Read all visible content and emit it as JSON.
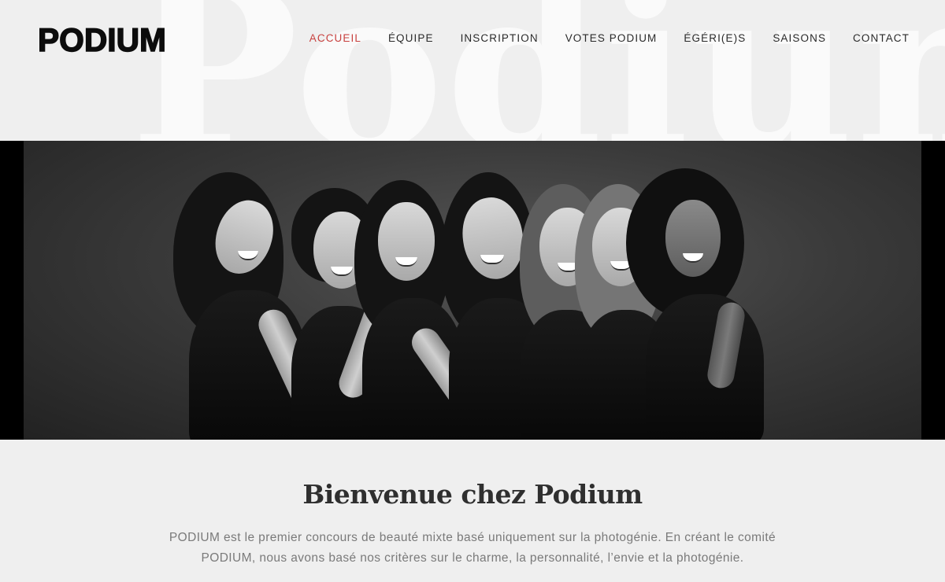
{
  "brand": {
    "logo_text": "PODIUM",
    "watermark_text": "Podium"
  },
  "nav": {
    "items": [
      {
        "label": "ACCUEIL",
        "active": true
      },
      {
        "label": "ÉQUIPE",
        "active": false
      },
      {
        "label": "INSCRIPTION",
        "active": false
      },
      {
        "label": "VOTES PODIUM",
        "active": false
      },
      {
        "label": "ÉGÉRI(E)S",
        "active": false
      },
      {
        "label": "SAISONS",
        "active": false
      },
      {
        "label": "CONTACT",
        "active": false
      }
    ]
  },
  "hero": {
    "image_description_icon": "group-photo"
  },
  "intro": {
    "title": "Bienvenue chez Podium",
    "line1": "PODIUM est le premier concours de beauté mixte basé uniquement sur la photogénie. En créant le comité",
    "line2": "PODIUM, nous avons basé nos critères sur le charme, la personnalité, l’envie et la photogénie."
  },
  "colors": {
    "accent": "#c8413f",
    "background": "#efefef",
    "text_dark": "#2f2f2f",
    "text_muted": "#7a7a7a"
  }
}
